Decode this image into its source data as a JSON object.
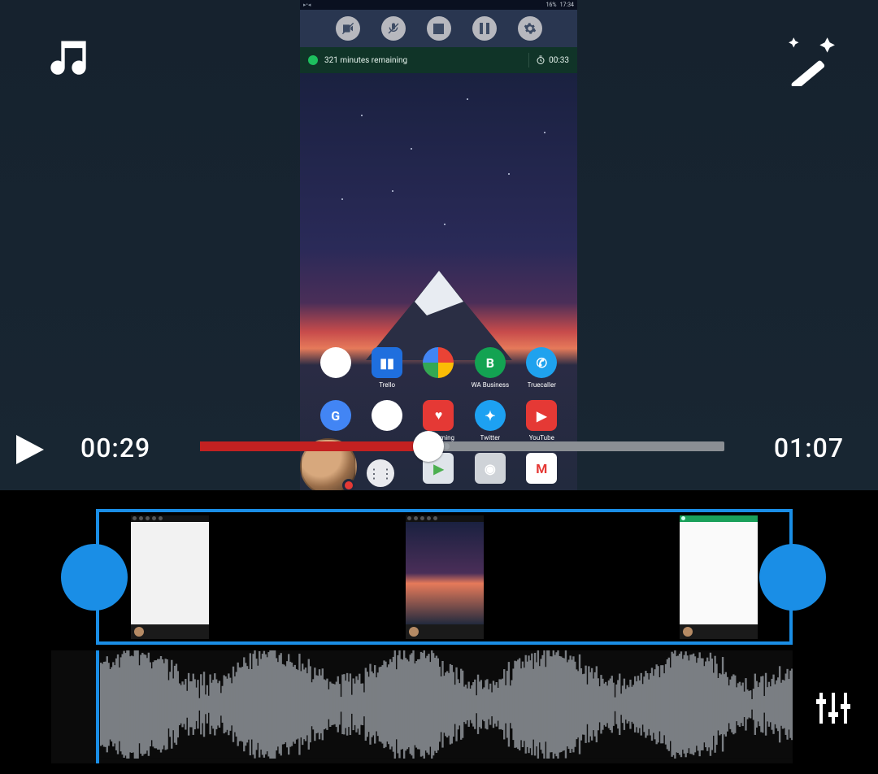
{
  "status_bar": {
    "left": "▸•◂",
    "signal": "📶",
    "wifi": "📡",
    "battery_pct": "16%",
    "clock": "17:34"
  },
  "rec_toolbar": {
    "video_off": "video-off",
    "mic_off": "mic-off",
    "stop": "stop",
    "pause": "pause",
    "settings": "settings"
  },
  "green_bar": {
    "remaining": "321 minutes remaining",
    "elapsed": "00:33"
  },
  "home_apps_row1": [
    {
      "label": "",
      "color": "#fff"
    },
    {
      "label": "Trello",
      "color": "#1f6fde"
    },
    {
      "label": "",
      "color": "#fff"
    },
    {
      "label": "WA Business",
      "color": "#13a352"
    },
    {
      "label": "Truecaller",
      "color": "#1fa2ee"
    }
  ],
  "home_apps_row2": [
    {
      "label": "",
      "color": "#fff"
    },
    {
      "label": "",
      "color": "#fff"
    },
    {
      "label": "YT Gaming",
      "color": "#e53935"
    },
    {
      "label": "Twitter",
      "color": "#1da1f2"
    },
    {
      "label": "YouTube",
      "color": "#e53935"
    }
  ],
  "dock_apps": [
    {
      "label": "",
      "color": "#8fd18f"
    },
    {
      "label": "",
      "color": "#cfd3d8"
    },
    {
      "label": "",
      "color": "#e46a5e"
    }
  ],
  "playback": {
    "current": "00:29",
    "total": "01:07",
    "progress_pct": 43
  },
  "icons": {
    "music": "music",
    "wand": "magic-wand",
    "play": "play",
    "mixer": "mixer"
  }
}
